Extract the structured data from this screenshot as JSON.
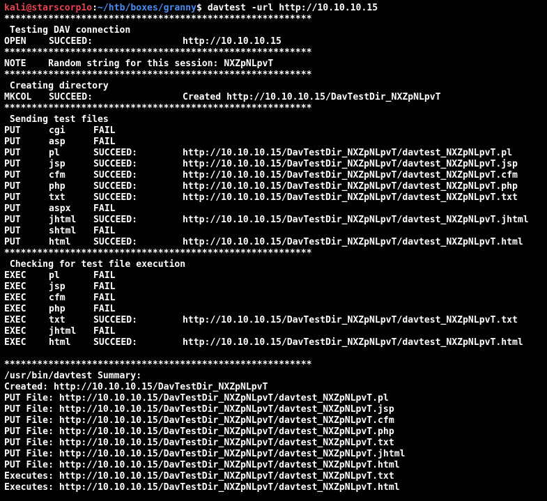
{
  "prompt": {
    "user_host": "kali@starscorp1o",
    "separator": ":",
    "path": "~/htb/boxes/granny",
    "symbol": "$",
    "command": " davtest -url http://10.10.10.15"
  },
  "separator_line": "********************************************************",
  "sections": {
    "testing": {
      "heading": " Testing DAV connection",
      "row": {
        "c1": "OPEN",
        "c2": "SUCCEED:",
        "c3": "http://10.10.10.15"
      }
    },
    "note": {
      "text": "NOTE    Random string for this session: NXZpNLpvT"
    },
    "creating": {
      "heading": " Creating directory",
      "row": {
        "c1": "MKCOL",
        "c2": "SUCCEED:",
        "c3": "Created http://10.10.10.15/DavTestDir_NXZpNLpvT"
      }
    },
    "sending": {
      "heading": " Sending test files",
      "rows": [
        {
          "a": "PUT",
          "b": "cgi",
          "c": "FAIL",
          "d": ""
        },
        {
          "a": "PUT",
          "b": "asp",
          "c": "FAIL",
          "d": ""
        },
        {
          "a": "PUT",
          "b": "pl",
          "c": "SUCCEED:",
          "d": "http://10.10.10.15/DavTestDir_NXZpNLpvT/davtest_NXZpNLpvT.pl"
        },
        {
          "a": "PUT",
          "b": "jsp",
          "c": "SUCCEED:",
          "d": "http://10.10.10.15/DavTestDir_NXZpNLpvT/davtest_NXZpNLpvT.jsp"
        },
        {
          "a": "PUT",
          "b": "cfm",
          "c": "SUCCEED:",
          "d": "http://10.10.10.15/DavTestDir_NXZpNLpvT/davtest_NXZpNLpvT.cfm"
        },
        {
          "a": "PUT",
          "b": "php",
          "c": "SUCCEED:",
          "d": "http://10.10.10.15/DavTestDir_NXZpNLpvT/davtest_NXZpNLpvT.php"
        },
        {
          "a": "PUT",
          "b": "txt",
          "c": "SUCCEED:",
          "d": "http://10.10.10.15/DavTestDir_NXZpNLpvT/davtest_NXZpNLpvT.txt"
        },
        {
          "a": "PUT",
          "b": "aspx",
          "c": "FAIL",
          "d": ""
        },
        {
          "a": "PUT",
          "b": "jhtml",
          "c": "SUCCEED:",
          "d": "http://10.10.10.15/DavTestDir_NXZpNLpvT/davtest_NXZpNLpvT.jhtml"
        },
        {
          "a": "PUT",
          "b": "shtml",
          "c": "FAIL",
          "d": ""
        },
        {
          "a": "PUT",
          "b": "html",
          "c": "SUCCEED:",
          "d": "http://10.10.10.15/DavTestDir_NXZpNLpvT/davtest_NXZpNLpvT.html"
        }
      ]
    },
    "checking": {
      "heading": " Checking for test file execution",
      "rows": [
        {
          "a": "EXEC",
          "b": "pl",
          "c": "FAIL",
          "d": ""
        },
        {
          "a": "EXEC",
          "b": "jsp",
          "c": "FAIL",
          "d": ""
        },
        {
          "a": "EXEC",
          "b": "cfm",
          "c": "FAIL",
          "d": ""
        },
        {
          "a": "EXEC",
          "b": "php",
          "c": "FAIL",
          "d": ""
        },
        {
          "a": "EXEC",
          "b": "txt",
          "c": "SUCCEED:",
          "d": "http://10.10.10.15/DavTestDir_NXZpNLpvT/davtest_NXZpNLpvT.txt"
        },
        {
          "a": "EXEC",
          "b": "jhtml",
          "c": "FAIL",
          "d": ""
        },
        {
          "a": "EXEC",
          "b": "html",
          "c": "SUCCEED:",
          "d": "http://10.10.10.15/DavTestDir_NXZpNLpvT/davtest_NXZpNLpvT.html"
        }
      ]
    },
    "summary": {
      "heading": "/usr/bin/davtest Summary:",
      "lines": [
        "Created: http://10.10.10.15/DavTestDir_NXZpNLpvT",
        "PUT File: http://10.10.10.15/DavTestDir_NXZpNLpvT/davtest_NXZpNLpvT.pl",
        "PUT File: http://10.10.10.15/DavTestDir_NXZpNLpvT/davtest_NXZpNLpvT.jsp",
        "PUT File: http://10.10.10.15/DavTestDir_NXZpNLpvT/davtest_NXZpNLpvT.cfm",
        "PUT File: http://10.10.10.15/DavTestDir_NXZpNLpvT/davtest_NXZpNLpvT.php",
        "PUT File: http://10.10.10.15/DavTestDir_NXZpNLpvT/davtest_NXZpNLpvT.txt",
        "PUT File: http://10.10.10.15/DavTestDir_NXZpNLpvT/davtest_NXZpNLpvT.jhtml",
        "PUT File: http://10.10.10.15/DavTestDir_NXZpNLpvT/davtest_NXZpNLpvT.html",
        "Executes: http://10.10.10.15/DavTestDir_NXZpNLpvT/davtest_NXZpNLpvT.txt",
        "Executes: http://10.10.10.15/DavTestDir_NXZpNLpvT/davtest_NXZpNLpvT.html"
      ]
    }
  },
  "colors": {
    "background": "#000000",
    "text": "#ffffff",
    "prompt_user": "#e8434f",
    "prompt_path": "#4a8cf0"
  }
}
